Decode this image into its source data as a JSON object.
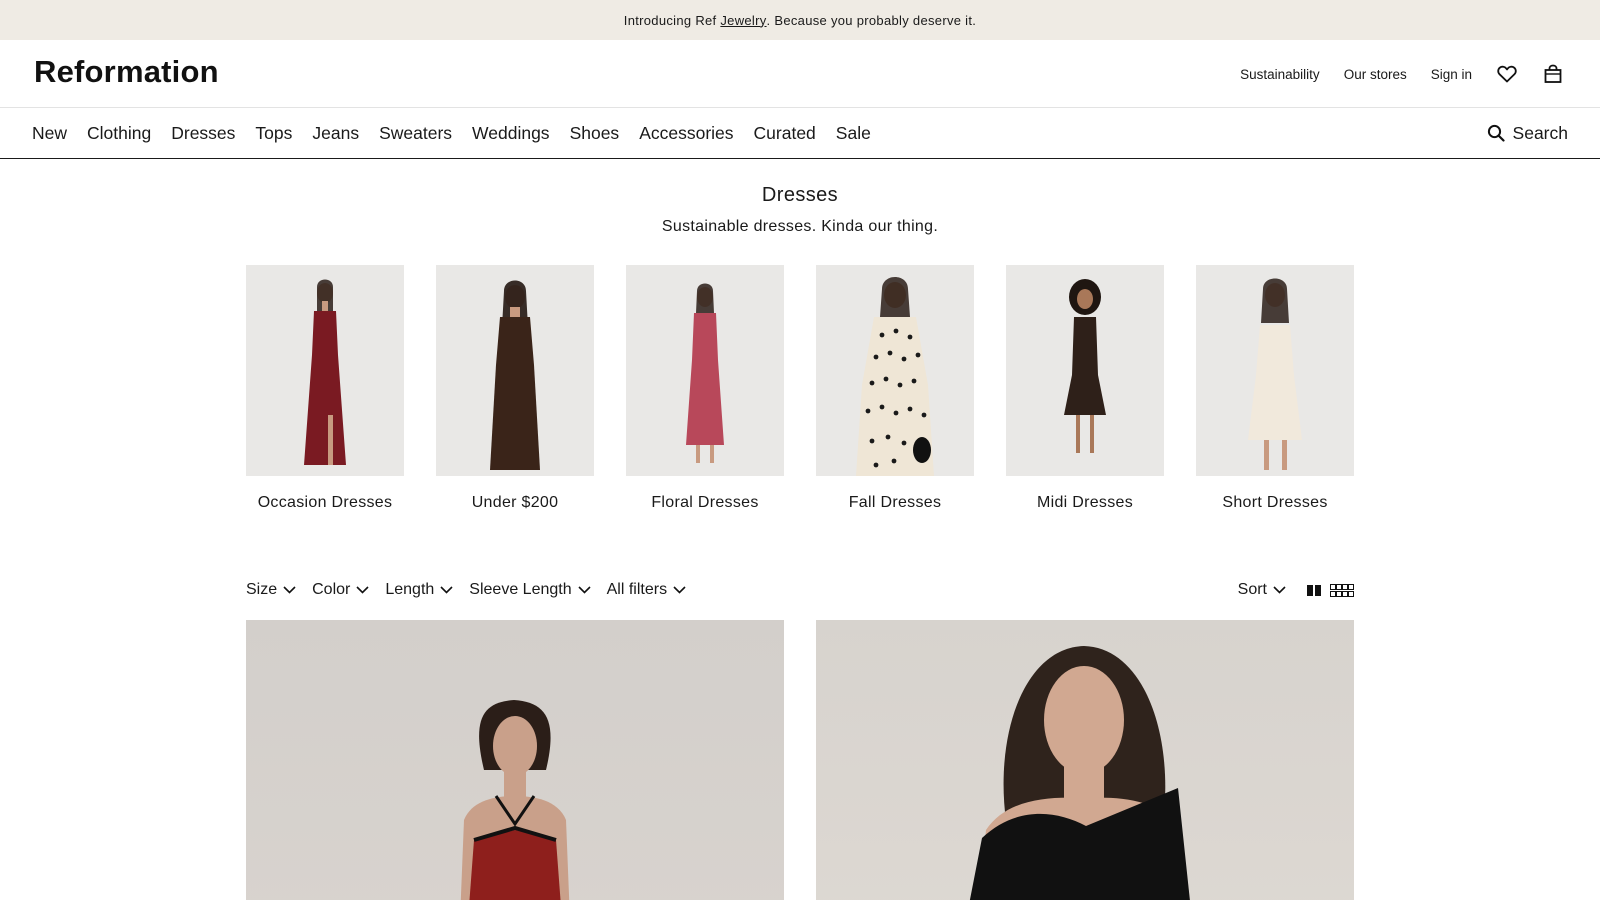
{
  "promo": {
    "prefix": "Introducing Ref ",
    "link": "Jewelry",
    "suffix": ". Because you probably deserve it."
  },
  "header": {
    "logo": "Reformation",
    "links": [
      "Sustainability",
      "Our stores",
      "Sign in"
    ],
    "icons": [
      "heart-icon",
      "shopping-bag-icon"
    ]
  },
  "nav": {
    "items": [
      "New",
      "Clothing",
      "Dresses",
      "Tops",
      "Jeans",
      "Sweaters",
      "Weddings",
      "Shoes",
      "Accessories",
      "Curated",
      "Sale"
    ],
    "search_label": "Search"
  },
  "page": {
    "title": "Dresses",
    "subtitle": "Sustainable dresses. Kinda our thing."
  },
  "categories": [
    {
      "label": "Occasion Dresses",
      "dress_color": "#7a1a22"
    },
    {
      "label": "Under $200",
      "dress_color": "#3a2419"
    },
    {
      "label": "Floral Dresses",
      "dress_color": "#b8485a"
    },
    {
      "label": "Fall Dresses",
      "dress_color": "#efe6d6"
    },
    {
      "label": "Midi Dresses",
      "dress_color": "#2e2019"
    },
    {
      "label": "Short Dresses",
      "dress_color": "#f1e9dc"
    }
  ],
  "filters": {
    "items": [
      "Size",
      "Color",
      "Length",
      "Sleeve Length",
      "All filters"
    ],
    "sort_label": "Sort",
    "view_icons": [
      "two-column-view-icon",
      "four-column-view-icon"
    ]
  },
  "products": [
    {
      "dress_color": "#8e1f1c"
    },
    {
      "dress_color": "#111111"
    }
  ]
}
